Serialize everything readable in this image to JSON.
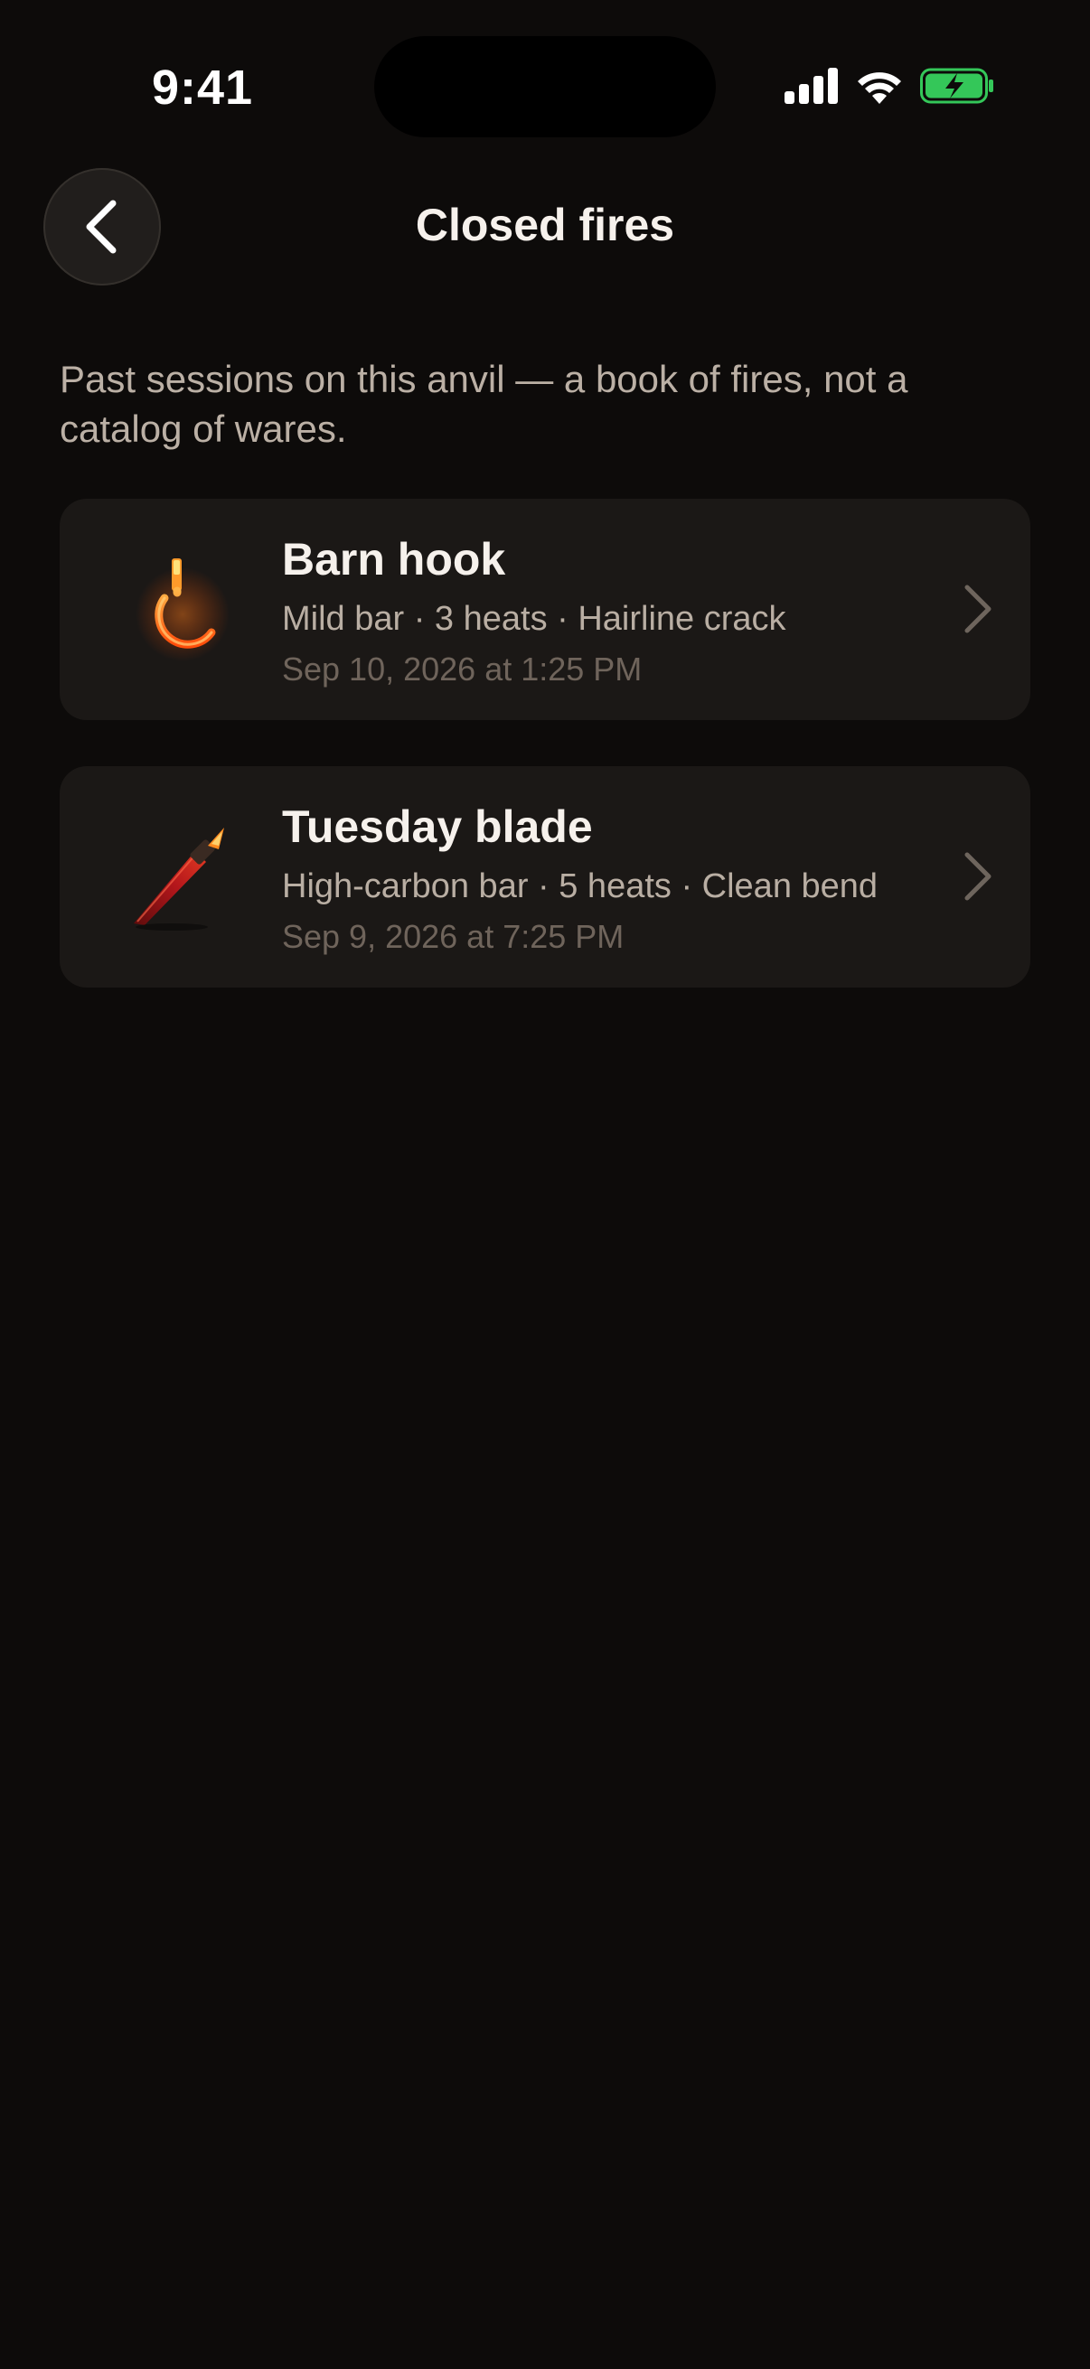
{
  "status_bar": {
    "time": "9:41"
  },
  "header": {
    "title": "Closed fires",
    "back_icon": "chevron-left-icon"
  },
  "subtitle": "Past sessions on this anvil — a book of fires, not a catalog of wares.",
  "sessions": [
    {
      "name": "Barn hook",
      "meta": "Mild bar · 3 heats · Hairline crack",
      "date": "Sep 10, 2026 at 1:25 PM",
      "icon": "glowing-hook-icon"
    },
    {
      "name": "Tuesday blade",
      "meta": "High-carbon bar · 5 heats · Clean bend",
      "date": "Sep 9, 2026 at 7:25 PM",
      "icon": "glowing-blade-icon"
    }
  ],
  "colors": {
    "background": "#0d0b0a",
    "card": "#1b1816",
    "accent_glow": "#ff6a1a",
    "battery": "#34c759"
  }
}
